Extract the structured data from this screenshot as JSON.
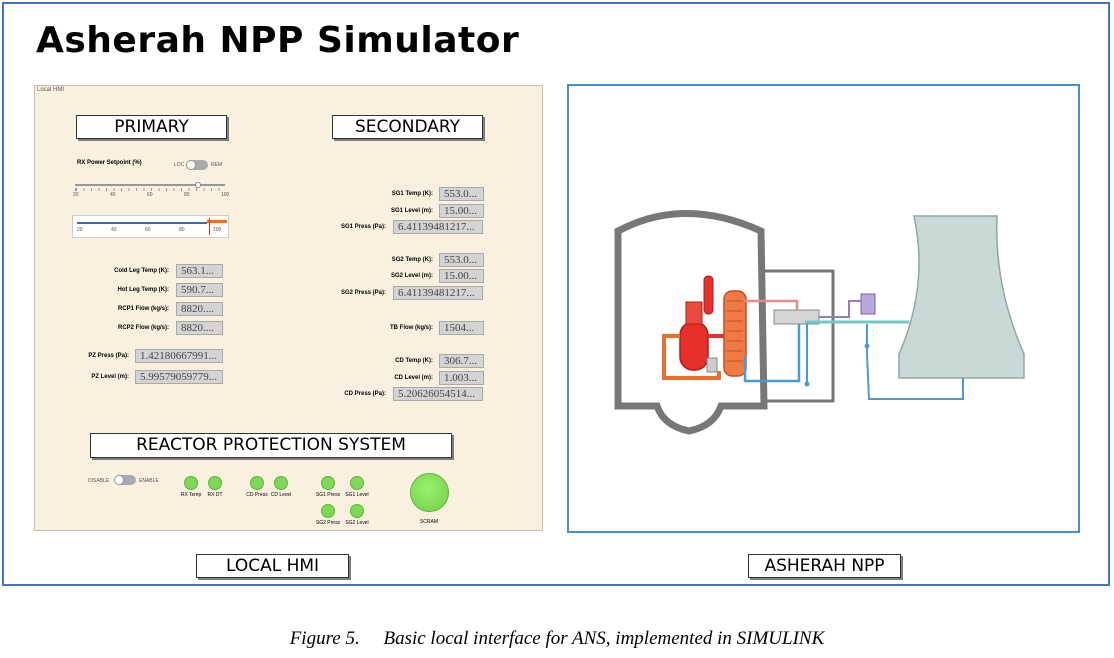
{
  "title": "Asherah NPP Simulator",
  "hmi": {
    "window_tag": "Local HMI",
    "primary": {
      "heading": "PRIMARY",
      "power_setpoint_label": "RX Power Setpoint (%)",
      "toggle_left": "LOC",
      "toggle_right": "REM",
      "slider_ticks": [
        "20",
        "40",
        "60",
        "80",
        "100"
      ],
      "slider_value_pct": 0.82,
      "gauge_ticks": [
        "20",
        "40",
        "60",
        "80",
        "100"
      ],
      "fields": [
        {
          "label": "Cold Leg Temp (K):",
          "value": "563.1..."
        },
        {
          "label": "Hot Leg Temp (K):",
          "value": "590.7..."
        },
        {
          "label": "RCP1 Flow (kg/s):",
          "value": "8820...."
        },
        {
          "label": "RCP2 Flow (kg/s):",
          "value": "8820...."
        },
        {
          "label": "PZ Press (Pa):",
          "value": "1.42180667991..."
        },
        {
          "label": "PZ Level (m):",
          "value": "5.99579059779..."
        }
      ]
    },
    "secondary": {
      "heading": "SECONDARY",
      "fields": [
        {
          "label": "SG1 Temp (K):",
          "value": "553.0..."
        },
        {
          "label": "SG1 Level (m):",
          "value": "15.00..."
        },
        {
          "label": "SG1 Press (Pa):",
          "value": "6.41139481217..."
        },
        {
          "label": "SG2 Temp (K):",
          "value": "553.0..."
        },
        {
          "label": "SG2 Level (m):",
          "value": "15.00..."
        },
        {
          "label": "SG2 Press (Pa):",
          "value": "6.41139481217..."
        },
        {
          "label": "TB Flow (kg/s):",
          "value": "1504..."
        },
        {
          "label": "CD Temp (K):",
          "value": "306.7..."
        },
        {
          "label": "CD Level (m):",
          "value": "1.003..."
        },
        {
          "label": "CD Press (Pa):",
          "value": "5.20626054514..."
        }
      ]
    },
    "rps": {
      "heading": "REACTOR PROTECTION SYSTEM",
      "toggle_left": "DISABLE",
      "toggle_right": "ENABLE",
      "indicators": [
        "RX Temp",
        "RX DT",
        "CD Press",
        "CD Level",
        "SG1 Press",
        "SG1 Level",
        "SG2 Press",
        "SG2 Level"
      ],
      "scram_label": "SCRAM",
      "indicator_color": "#7ed957"
    }
  },
  "labels": {
    "local_hmi": "LOCAL HMI",
    "asherah_npp": "ASHERAH NPP"
  },
  "caption": "Figure 5.     Basic local interface for ANS, implemented in SIMULINK",
  "colors": {
    "frame": "#4a72b8",
    "hmi_bg": "#faf0e0",
    "reactor": "#e8302a",
    "steam_generator": "#f07a45",
    "cooling_tower": "#c9d9d6",
    "feedwater": "#4b9bd1"
  }
}
